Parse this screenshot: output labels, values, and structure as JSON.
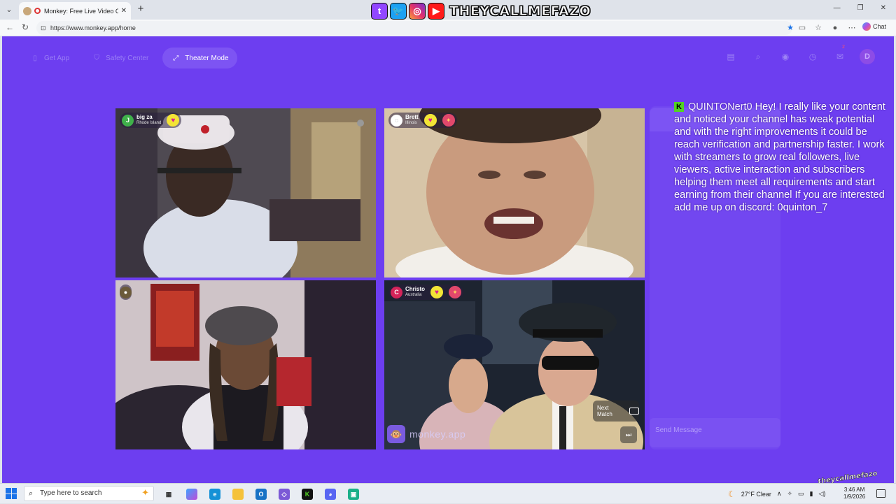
{
  "browser": {
    "tab_title": "Monkey: Free Live Video Chat",
    "url": "https://www.monkey.app/home",
    "chat_label": "Chat"
  },
  "banner": {
    "text": "THEYCALLMEFAZO"
  },
  "nav": {
    "get_app": "Get App",
    "safety_center": "Safety Center",
    "theater_mode": "Theater Mode",
    "avatar_letter": "D",
    "notif_count": "2"
  },
  "tiles": [
    {
      "initial": "J",
      "name": "big za",
      "location": "Rhode Island",
      "avatar_color": "#3fb04a"
    },
    {
      "initial": "",
      "name": "Brett",
      "location": "Illinois",
      "avatar_color": "#ffffff"
    },
    {
      "initial": "",
      "name": "",
      "location": "",
      "avatar_color": "#6b5a3a"
    },
    {
      "initial": "C",
      "name": "Christo",
      "location": "Australia",
      "avatar_color": "#d4245a"
    }
  ],
  "controls": {
    "next_match": "Next Match",
    "logo_text": "monkey.app",
    "send_placeholder": "Send Message"
  },
  "overlay": {
    "username": "QUINTONert0",
    "message": "Hey! I really like your content and noticed your channel has weak potential and with the right improvements it could be reach verification and partnership faster. I work with streamers to grow real followers, live viewers, active interaction and subscribers helping them meet all requirements and start earning from their channel If you are interested add me up on discord: 0quinton_7"
  },
  "watermark": "theycallmefazo",
  "taskbar": {
    "search_placeholder": "Type here to search",
    "weather": "27°F  Clear",
    "time": "3:46 AM",
    "date": "1/9/2026"
  }
}
